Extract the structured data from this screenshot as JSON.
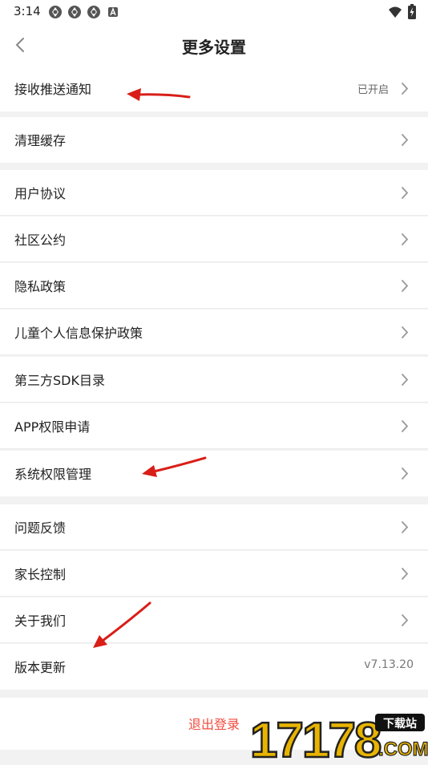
{
  "status_bar": {
    "time": "3:14",
    "notification_icons": [
      "app-icon",
      "app-icon",
      "app-icon",
      "a-icon"
    ],
    "right_icons": [
      "wifi-icon",
      "battery-icon"
    ]
  },
  "header": {
    "back_icon": "chevron-left-icon",
    "title": "更多设置"
  },
  "groups": [
    {
      "items": [
        {
          "id": "push",
          "label": "接收推送通知",
          "value": "已开启"
        }
      ]
    },
    {
      "items": [
        {
          "id": "cache",
          "label": "清理缓存"
        }
      ]
    },
    {
      "items": [
        {
          "id": "user-agreement",
          "label": "用户协议"
        },
        {
          "id": "community",
          "label": "社区公约"
        },
        {
          "id": "privacy",
          "label": "隐私政策"
        },
        {
          "id": "child-privacy",
          "label": "儿童个人信息保护政策"
        },
        {
          "id": "sdk",
          "label": "第三方SDK目录"
        },
        {
          "id": "app-permission",
          "label": "APP权限申请"
        },
        {
          "id": "system-permission",
          "label": "系统权限管理"
        }
      ]
    },
    {
      "items": [
        {
          "id": "feedback",
          "label": "问题反馈"
        },
        {
          "id": "parental",
          "label": "家长控制"
        },
        {
          "id": "about",
          "label": "关于我们"
        },
        {
          "id": "version",
          "label": "版本更新",
          "value": "v7.13.20"
        }
      ]
    }
  ],
  "logout_label": "退出登录",
  "watermark": {
    "text": "17178",
    "badge": "下载站",
    "suffix": ".COM"
  },
  "colors": {
    "accent": "#f24b3f",
    "annotation_arrow": "#d91e18",
    "background": "#f2f2f2"
  }
}
